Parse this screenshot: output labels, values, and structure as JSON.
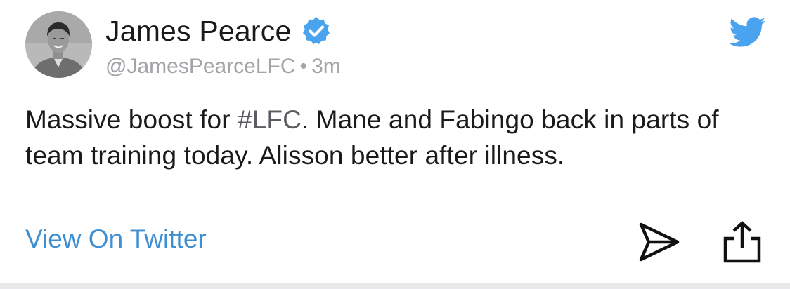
{
  "tweet": {
    "author_name": "James Pearce",
    "handle": "@JamesPearceLFC",
    "separator": "•",
    "timestamp": "3m",
    "verified": true,
    "text_before_hashtag": "Massive boost for ",
    "hashtag": "#LFC",
    "text_after_hashtag": ". Mane and Fabingo back in parts of team training today. Alisson better after illness."
  },
  "actions": {
    "view_on_twitter": "View On Twitter"
  },
  "icons": {
    "brand": "twitter-bird-icon",
    "verified": "verified-badge-icon",
    "send": "send-icon",
    "share": "share-icon"
  },
  "colors": {
    "link": "#3f8fd0",
    "twitter_blue": "#4aa3ee",
    "verified_blue": "#4aa3ee",
    "text": "#1a1a1a",
    "muted": "#a3a3a8"
  }
}
